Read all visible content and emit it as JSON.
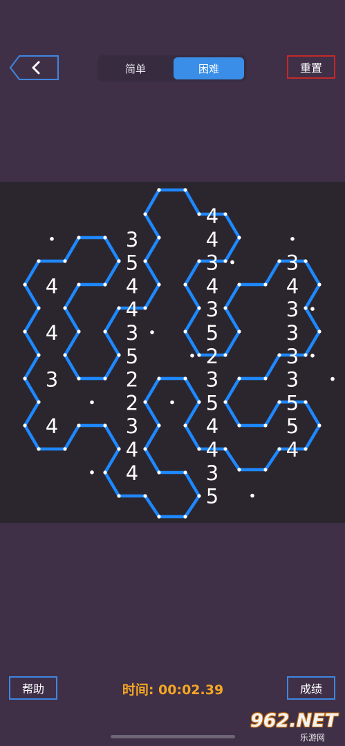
{
  "header": {
    "difficulty_tabs": [
      {
        "label": "简单",
        "selected": false
      },
      {
        "label": "困难",
        "selected": true
      }
    ],
    "reset_label": "重置"
  },
  "board": {
    "line_color": "#1e88ff",
    "dot_color": "#ffffff",
    "numbers": [
      {
        "row": 0,
        "col": 1,
        "value": "4"
      },
      {
        "row": 1,
        "col": 0,
        "value": "3"
      },
      {
        "row": 1,
        "col": 2,
        "value": "4"
      },
      {
        "row": 2,
        "col": -1,
        "value": "5"
      },
      {
        "row": 2,
        "col": 1,
        "value": "3"
      },
      {
        "row": 2,
        "col": 3,
        "value": "3"
      },
      {
        "row": 3,
        "col": -2,
        "value": "4"
      },
      {
        "row": 3,
        "col": 0,
        "value": "4"
      },
      {
        "row": 3,
        "col": 2,
        "value": "4"
      },
      {
        "row": 3,
        "col": 4,
        "value": "4"
      },
      {
        "row": 4,
        "col": -1,
        "value": "4"
      },
      {
        "row": 4,
        "col": 1,
        "value": "3"
      },
      {
        "row": 4,
        "col": 3,
        "value": "3"
      },
      {
        "row": 5,
        "col": -2,
        "value": "4"
      },
      {
        "row": 5,
        "col": 0,
        "value": "3"
      },
      {
        "row": 5,
        "col": 2,
        "value": "5"
      },
      {
        "row": 5,
        "col": 4,
        "value": "3"
      },
      {
        "row": 6,
        "col": -1,
        "value": "5"
      },
      {
        "row": 6,
        "col": 1,
        "value": "2"
      },
      {
        "row": 6,
        "col": 3,
        "value": "3"
      },
      {
        "row": 7,
        "col": -2,
        "value": "3"
      },
      {
        "row": 7,
        "col": 0,
        "value": "2"
      },
      {
        "row": 7,
        "col": 2,
        "value": "3"
      },
      {
        "row": 7,
        "col": 4,
        "value": "3"
      },
      {
        "row": 8,
        "col": -1,
        "value": "2"
      },
      {
        "row": 8,
        "col": 1,
        "value": "5"
      },
      {
        "row": 8,
        "col": 3,
        "value": "5"
      },
      {
        "row": 9,
        "col": -2,
        "value": "4"
      },
      {
        "row": 9,
        "col": 0,
        "value": "3"
      },
      {
        "row": 9,
        "col": 2,
        "value": "4"
      },
      {
        "row": 9,
        "col": 4,
        "value": "5"
      },
      {
        "row": 10,
        "col": -1,
        "value": "4"
      },
      {
        "row": 10,
        "col": 1,
        "value": "4"
      },
      {
        "row": 10,
        "col": 3,
        "value": "4"
      },
      {
        "row": 11,
        "col": 0,
        "value": "4"
      },
      {
        "row": 11,
        "col": 2,
        "value": "3"
      },
      {
        "row": 12,
        "col": 1,
        "value": "5"
      }
    ],
    "empty_dots": [
      {
        "row": 1,
        "col": -2
      },
      {
        "row": 1,
        "col": 4
      },
      {
        "row": 2,
        "col": 1.5
      },
      {
        "row": 4,
        "col": 3.5
      },
      {
        "row": 5,
        "col": 0.5
      },
      {
        "row": 6,
        "col": 0.5
      },
      {
        "row": 6,
        "col": 3.5
      },
      {
        "row": 7,
        "col": 5
      },
      {
        "row": 8,
        "col": -2
      },
      {
        "row": 8,
        "col": 0
      },
      {
        "row": 11,
        "col": -1
      },
      {
        "row": 12,
        "col": 2
      }
    ]
  },
  "footer": {
    "help_label": "帮助",
    "timer_text": "时间: 00:02.39",
    "score_label": "成绩"
  },
  "watermark": {
    "main": "962.NET",
    "sub": "乐游网"
  }
}
